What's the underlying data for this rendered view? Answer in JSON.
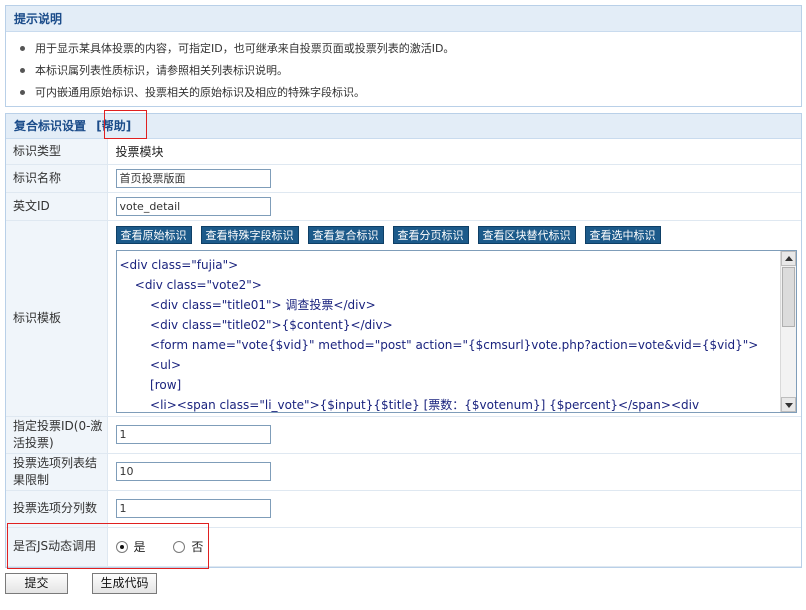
{
  "tips": {
    "title": "提示说明",
    "items": [
      "用于显示某具体投票的内容，可指定ID，也可继承来自投票页面或投票列表的激活ID。",
      "本标识属列表性质标识，请参照相关列表标识说明。",
      "可内嵌通用原始标识、投票相关的原始标识及相应的特殊字段标识。"
    ]
  },
  "form": {
    "title": "复合标识设置",
    "help_label": "[帮助]",
    "rows": {
      "type_label": "标识类型",
      "type_value": "投票模块",
      "name_label": "标识名称",
      "name_value": "首页投票版面",
      "en_label": "英文ID",
      "en_value": "vote_detail",
      "template_label": "标识模板",
      "vid_label": "指定投票ID(0-激活投票)",
      "vid_value": "1",
      "limit_label": "投票选项列表结果限制",
      "limit_value": "10",
      "cols_label": "投票选项分列数",
      "cols_value": "1",
      "js_label": "是否JS动态调用",
      "js_yes": "是",
      "js_no": "否"
    },
    "template_buttons": [
      "查看原始标识",
      "查看特殊字段标识",
      "查看复合标识",
      "查看分页标识",
      "查看区块替代标识",
      "查看选中标识"
    ],
    "template_lines": [
      "<div class=\"fujia\">",
      "    <div class=\"vote2\">",
      "        <div class=\"title01\"> 调查投票</div>",
      "        <div class=\"title02\">{$content}</div>",
      "        <form name=\"vote{$vid}\" method=\"post\" action=\"{$cmsurl}vote.php?action=vote&vid={$vid}\">",
      "        <ul>",
      "        [row]",
      "        <li><span class=\"li_vote\">{$input}{$title} [票数：{$votenum}] {$percent}</span><div"
    ]
  },
  "buttons": {
    "submit": "提交",
    "generate": "生成代码"
  }
}
